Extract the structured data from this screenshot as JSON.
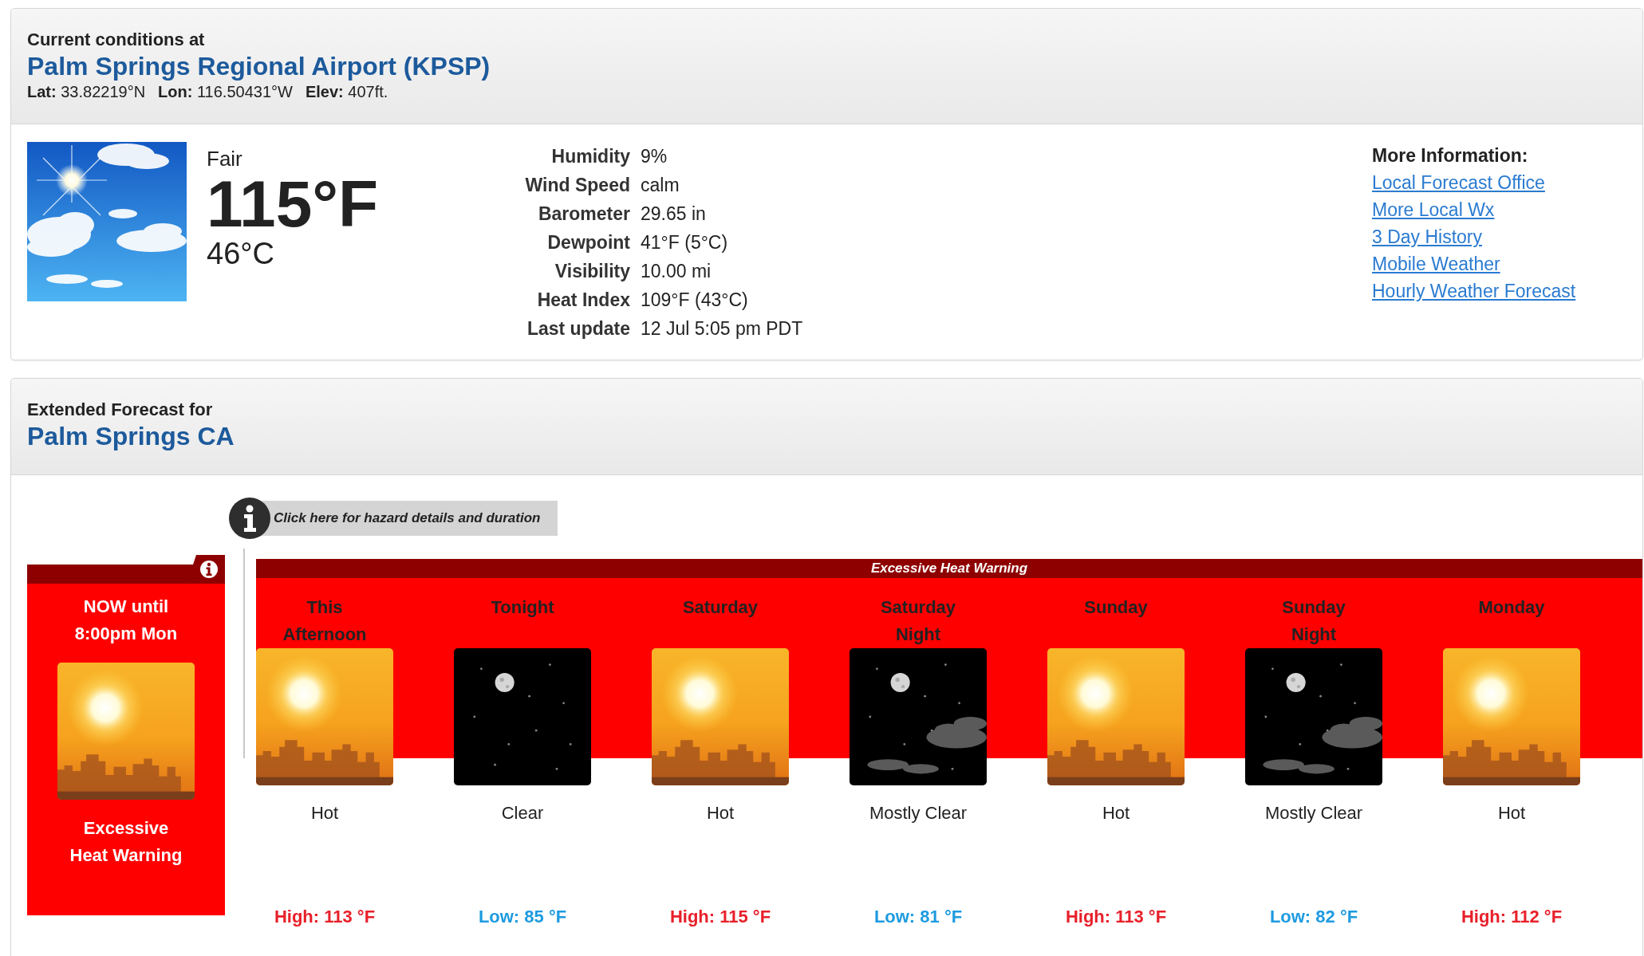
{
  "current": {
    "heading": "Current conditions at",
    "station": "Palm Springs Regional Airport (KPSP)",
    "coords": [
      {
        "label": "Lat:",
        "value": "33.82219°N"
      },
      {
        "label": "Lon:",
        "value": "116.50431°W"
      },
      {
        "label": "Elev:",
        "value": "407ft."
      }
    ],
    "condition": "Fair",
    "temp_f": "115°F",
    "temp_c": "46°C",
    "details": [
      {
        "label": "Humidity",
        "value": "9%"
      },
      {
        "label": "Wind Speed",
        "value": "calm"
      },
      {
        "label": "Barometer",
        "value": "29.65 in"
      },
      {
        "label": "Dewpoint",
        "value": "41°F (5°C)"
      },
      {
        "label": "Visibility",
        "value": "10.00 mi"
      },
      {
        "label": "Heat Index",
        "value": "109°F (43°C)"
      },
      {
        "label": "Last update",
        "value": "12 Jul 5:05 pm PDT"
      }
    ],
    "more_info": {
      "heading": "More Information:",
      "links": [
        "Local Forecast Office",
        "More Local Wx",
        "3 Day History",
        "Mobile Weather",
        "Hourly Weather Forecast"
      ]
    }
  },
  "forecast": {
    "heading": "Extended Forecast for",
    "location": "Palm Springs CA",
    "hazard_link": "Click here for hazard details and duration",
    "hazard": {
      "period": "NOW until 8:00pm Mon",
      "kind": "hot",
      "name": "Excessive Heat Warning"
    },
    "banner": "Excessive Heat Warning",
    "periods": [
      {
        "name": "This Afternoon",
        "kind": "hot",
        "desc": "Hot",
        "temp": "High: 113 °F",
        "color": "#e8202a"
      },
      {
        "name": "Tonight",
        "kind": "clear",
        "desc": "Clear",
        "temp": "Low: 85 °F",
        "color": "#1e9be0"
      },
      {
        "name": "Saturday",
        "kind": "hot",
        "desc": "Hot",
        "temp": "High: 115 °F",
        "color": "#e8202a"
      },
      {
        "name": "Saturday Night",
        "kind": "mostly_clear",
        "desc": "Mostly Clear",
        "temp": "Low: 81 °F",
        "color": "#1e9be0"
      },
      {
        "name": "Sunday",
        "kind": "hot",
        "desc": "Hot",
        "temp": "High: 113 °F",
        "color": "#e8202a"
      },
      {
        "name": "Sunday Night",
        "kind": "mostly_clear",
        "desc": "Mostly Clear",
        "temp": "Low: 82 °F",
        "color": "#1e9be0"
      },
      {
        "name": "Monday",
        "kind": "hot",
        "desc": "Hot",
        "temp": "High: 112 °F",
        "color": "#e8202a"
      }
    ]
  }
}
